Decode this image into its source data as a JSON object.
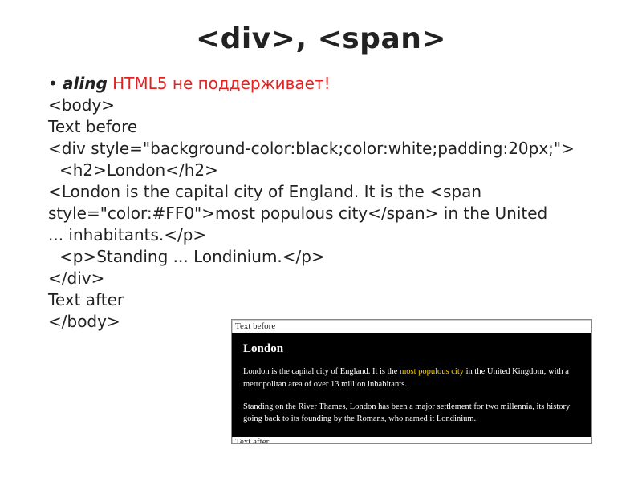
{
  "title": "<div>, <span>",
  "bullet": {
    "attr": "aling",
    "warn": "HTML5 не поддерживает!"
  },
  "code": {
    "l1": "<body>",
    "l2": "Text before",
    "l3": "<div style=\"background-color:black;color:white;padding:20px;\">",
    "l4": "  <h2>London</h2>",
    "l5a": "  <London is the capital city of England. It is the <span style=\"color:#FF0\">most populous city</span> in the United ",
    "l5b": "... inhabitants.</p>",
    "l6": "  <p>Standing ... Londinium.</p>",
    "l7": "</div>",
    "l8": "Text after",
    "l9": "</body>"
  },
  "preview": {
    "before": "Text before",
    "heading": "London",
    "p1a": "London is the capital city of England. It is the ",
    "p1highlight": "most populous city",
    "p1b": " in the United Kingdom, with a metropolitan area of over 13 million inhabitants.",
    "p2": "Standing on the River Thames, London has been a major settlement for two millennia, its history going back to its founding by the Romans, who named it Londinium.",
    "after": "Text after"
  }
}
